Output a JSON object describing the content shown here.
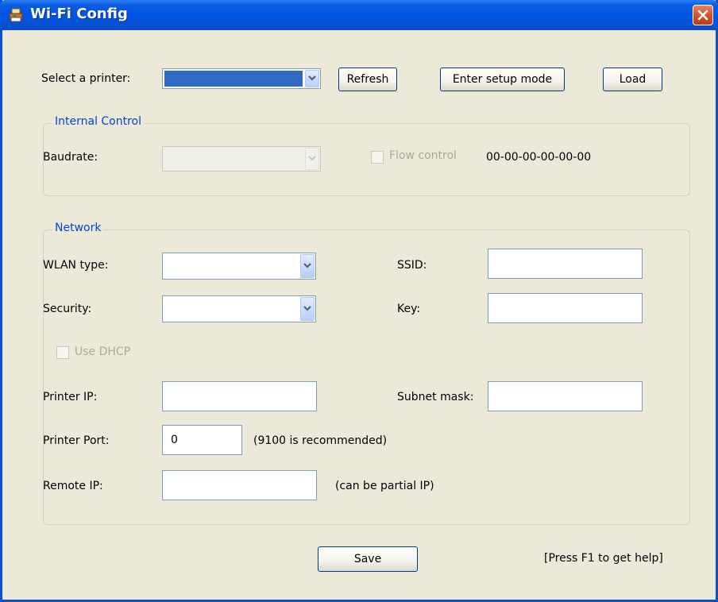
{
  "window": {
    "title": "Wi-Fi Config"
  },
  "printer": {
    "label": "Select a printer:",
    "refresh": "Refresh",
    "setup_mode": "Enter setup mode",
    "load": "Load"
  },
  "internal_control": {
    "title": "Internal Control",
    "baudrate_label": "Baudrate:",
    "flow_control_label": "Flow control",
    "mac_address": "00-00-00-00-00-00"
  },
  "network": {
    "title": "Network",
    "wlan_type_label": "WLAN type:",
    "security_label": "Security:",
    "ssid_label": "SSID:",
    "key_label": "Key:",
    "use_dhcp_label": "Use DHCP",
    "printer_ip_label": "Printer IP:",
    "subnet_mask_label": "Subnet mask:",
    "printer_port_label": "Printer Port:",
    "printer_port_value": "0",
    "printer_port_hint": "(9100 is recommended)",
    "remote_ip_label": "Remote IP:",
    "remote_ip_hint": "(can be partial IP)"
  },
  "footer": {
    "save": "Save",
    "help": "[Press F1 to get help]"
  }
}
